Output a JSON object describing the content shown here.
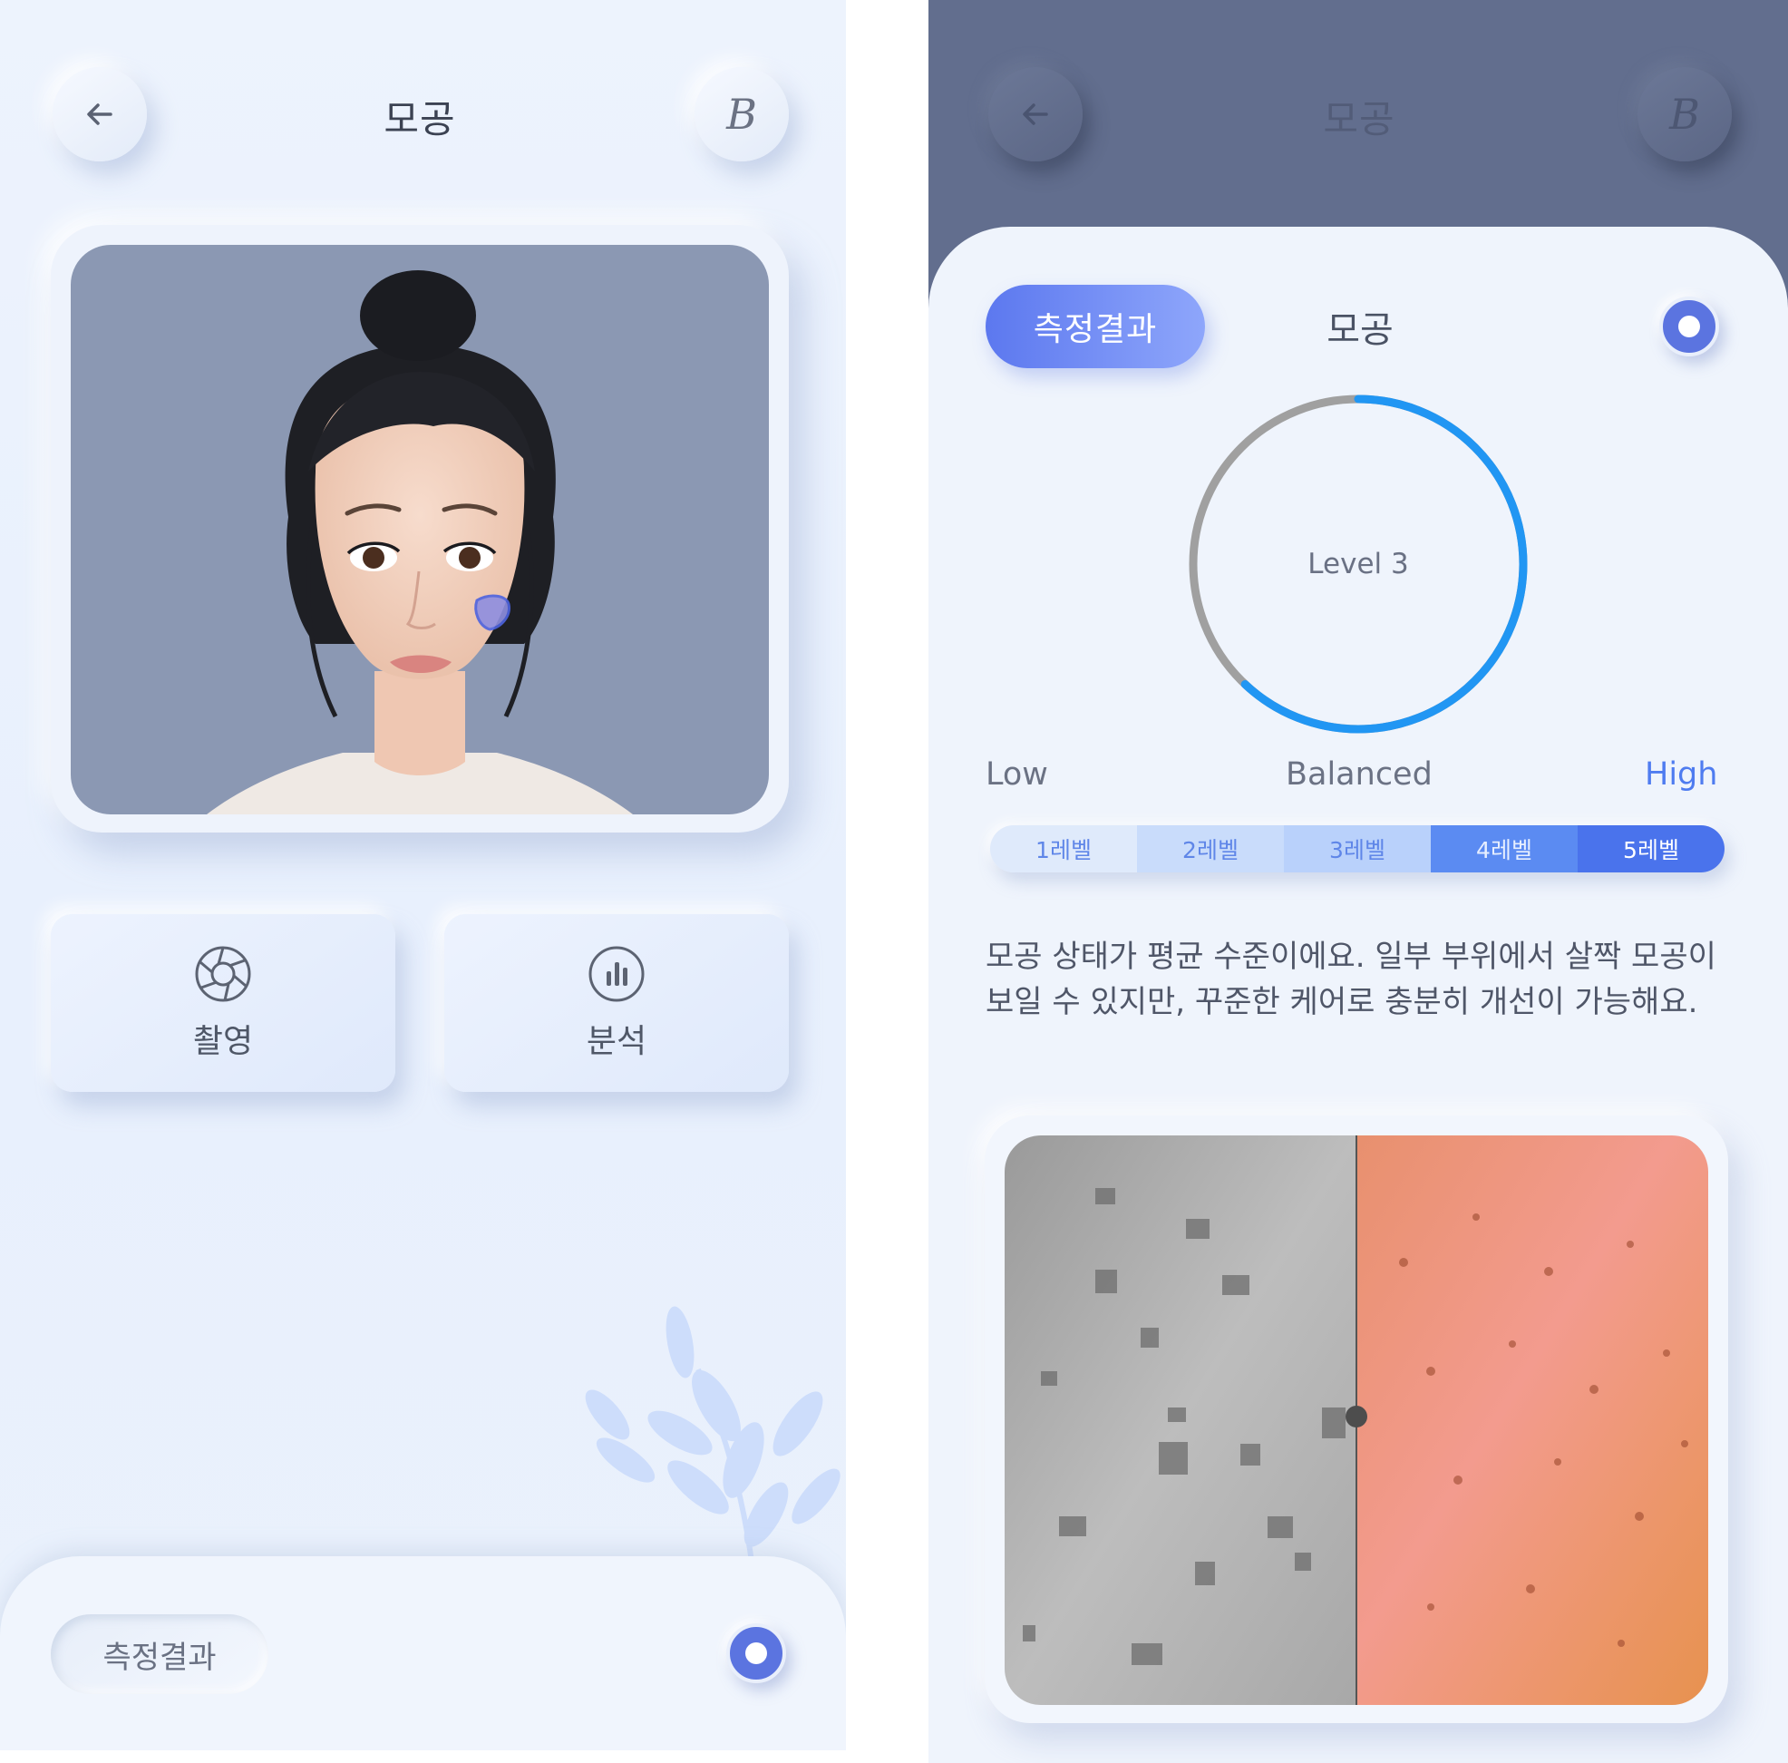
{
  "left_screen": {
    "header": {
      "back_icon": "arrow-left-icon",
      "title": "모공",
      "brand_icon": "brand-script-b-icon",
      "brand_glyph": "B"
    },
    "photo": {
      "subject": "face-illustration",
      "marker_icon": "pore-region-marker-icon"
    },
    "actions": [
      {
        "label": "촬영",
        "icon": "camera-shutter-icon"
      },
      {
        "label": "분석",
        "icon": "bar-chart-icon"
      }
    ],
    "bottom_bar": {
      "result_button_label": "측정결과",
      "toggle_icon": "radio-dot-icon"
    },
    "decoration_icon": "leaf-branch-icon"
  },
  "right_screen": {
    "header": {
      "back_icon": "arrow-left-icon",
      "title": "모공",
      "brand_icon": "brand-script-b-icon",
      "brand_glyph": "B"
    },
    "tabs": {
      "active_label": "측정결과",
      "category_label": "모공",
      "toggle_icon": "radio-dot-icon"
    },
    "gauge": {
      "label": "Level 3",
      "level": 3,
      "max_level": 5,
      "progress_fraction": 0.62
    },
    "scale": {
      "low": "Low",
      "mid": "Balanced",
      "high": "High"
    },
    "levels": [
      "1레벨",
      "2레벨",
      "3레벨",
      "4레벨",
      "5레벨"
    ],
    "description_line1": "모공 상태가 평균 수준이에요. 일부 부위에서 살짝 모공이",
    "description_line2": "보일 수 있지만, 꾸준한 케어로 충분히 개선이 가능해요.",
    "skin_image": {
      "left_half": "grayscale-pore-map",
      "right_half": "color-skin-closeup"
    }
  },
  "colors": {
    "accent": "#5b74e0",
    "gauge_progress": "#2196f3",
    "gauge_track": "#a0a0a0",
    "high_label": "#4f7cf0",
    "overlay_bg": "#626e8e"
  }
}
